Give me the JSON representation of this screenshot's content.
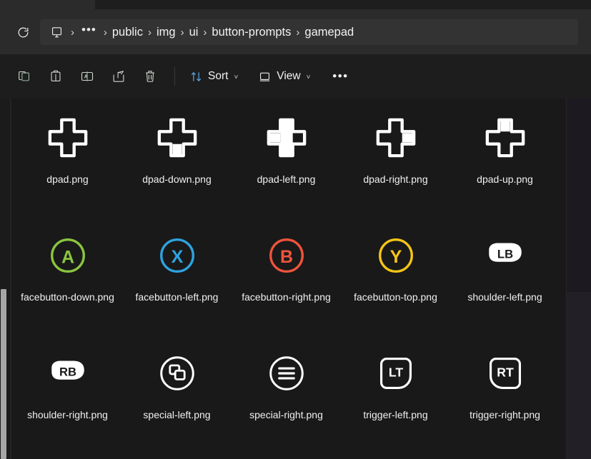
{
  "window": {
    "background_color": "#191919",
    "chrome_color": "#2b2b2b"
  },
  "address_bar": {
    "refresh_icon": "refresh-icon",
    "root_icon": "this-pc-icon",
    "overflow_label": "•••",
    "separator": "›",
    "breadcrumbs": [
      {
        "label": "public"
      },
      {
        "label": "img"
      },
      {
        "label": "ui"
      },
      {
        "label": "button-prompts"
      },
      {
        "label": "gamepad"
      }
    ]
  },
  "toolbar": {
    "icons": [
      {
        "name": "copy-icon",
        "title": "Copy"
      },
      {
        "name": "paste-icon",
        "title": "Paste"
      },
      {
        "name": "rename-icon",
        "title": "Rename"
      },
      {
        "name": "share-icon",
        "title": "Share"
      },
      {
        "name": "delete-icon",
        "title": "Delete"
      }
    ],
    "sort_label": "Sort",
    "view_label": "View",
    "caret": "˅",
    "more_label": "•••"
  },
  "files": [
    {
      "name": "dpad.png",
      "icon": "dpad-icon",
      "kind": "dpad",
      "fill": "none"
    },
    {
      "name": "dpad-down.png",
      "icon": "dpad-down-icon",
      "kind": "dpad",
      "fill": "down"
    },
    {
      "name": "dpad-left.png",
      "icon": "dpad-left-icon",
      "kind": "dpad",
      "fill": "left"
    },
    {
      "name": "dpad-right.png",
      "icon": "dpad-right-icon",
      "kind": "dpad",
      "fill": "right"
    },
    {
      "name": "dpad-up.png",
      "icon": "dpad-up-icon",
      "kind": "dpad",
      "fill": "up"
    },
    {
      "name": "facebutton-down.png",
      "icon": "facebutton-a-icon",
      "kind": "face",
      "letter": "A",
      "color": "#8bc53f"
    },
    {
      "name": "facebutton-left.png",
      "icon": "facebutton-x-icon",
      "kind": "face",
      "letter": "X",
      "color": "#2fa3e0"
    },
    {
      "name": "facebutton-right.png",
      "icon": "facebutton-b-icon",
      "kind": "face",
      "letter": "B",
      "color": "#f0543c"
    },
    {
      "name": "facebutton-top.png",
      "icon": "facebutton-y-icon",
      "kind": "face",
      "letter": "Y",
      "color": "#f5c518"
    },
    {
      "name": "shoulder-left.png",
      "icon": "shoulder-lb-icon",
      "kind": "bumper",
      "letter": "LB"
    },
    {
      "name": "shoulder-right.png",
      "icon": "shoulder-rb-icon",
      "kind": "bumper",
      "letter": "RB"
    },
    {
      "name": "special-left.png",
      "icon": "view-button-icon",
      "kind": "special-left"
    },
    {
      "name": "special-right.png",
      "icon": "menu-button-icon",
      "kind": "special-right"
    },
    {
      "name": "trigger-left.png",
      "icon": "trigger-lt-icon",
      "kind": "trigger",
      "letter": "LT",
      "side": "left"
    },
    {
      "name": "trigger-right.png",
      "icon": "trigger-rt-icon",
      "kind": "trigger",
      "letter": "RT",
      "side": "right"
    }
  ]
}
